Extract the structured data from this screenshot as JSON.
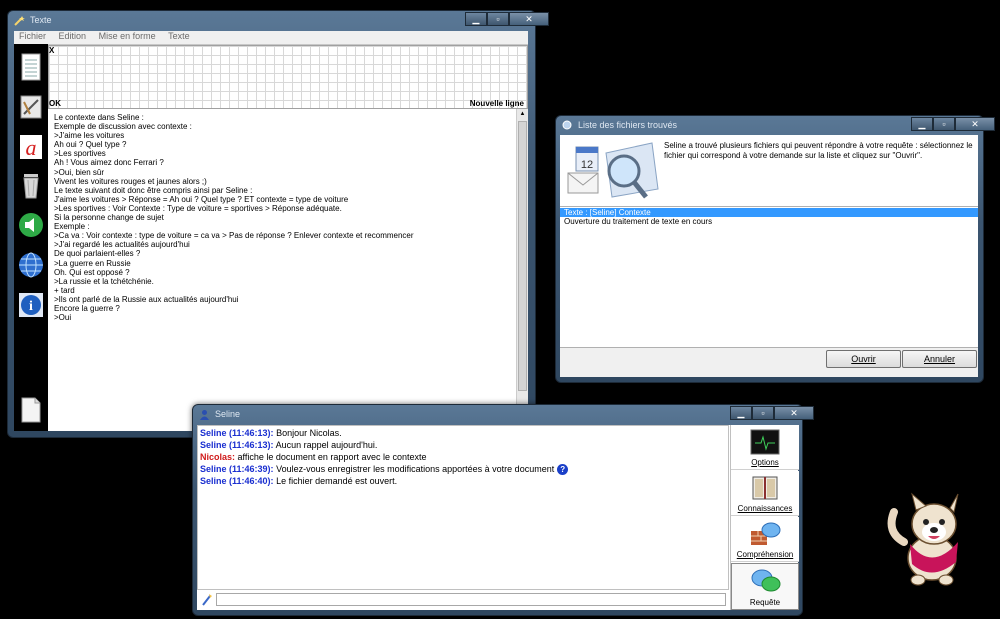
{
  "texte_window": {
    "title": "Texte",
    "menu": [
      "Fichier",
      "Edition",
      "Mise en forme",
      "Texte"
    ],
    "grid_label_x": "X",
    "grid_label_ok": "OK",
    "grid_label_newline": "Nouvelle ligne",
    "sidebar_icons": [
      "notepad-icon",
      "drawing-tools-icon",
      "font-letter-a-icon",
      "trash-icon",
      "speaker-icon",
      "globe-icon",
      "info-icon",
      "document-icon"
    ],
    "lines": [
      "Le contexte dans Seline :",
      "",
      "Exemple de discussion avec contexte :",
      "",
      ">J'aime les voitures",
      "Ah oui ? Quel type ?",
      ">Les sportives",
      "Ah ! Vous aimez donc Ferrari ?",
      ">Oui, bien sûr",
      "Vivent les voitures rouges et jaunes alors ;)",
      "",
      "Le texte suivant doit donc être compris ainsi par Seline :",
      "",
      "J'aime les voitures > Réponse = Ah oui ? Quel type ? ET contexte = type de voiture",
      "",
      ">Les sportives : Voir Contexte : Type de voiture = sportives > Réponse adéquate.",
      "Si la personne change de sujet",
      "",
      "Exemple :",
      "",
      ">Ca va : Voir contexte : type de voiture = ca va > Pas de réponse ? Enlever contexte et recommencer",
      "",
      ">J'ai regardé les actualités aujourd'hui",
      "De quoi parlaient-elles ?",
      ">La guerre en Russie",
      "Oh. Qui est opposé ?",
      ">La russie et la tchétchénie.",
      "",
      "+ tard",
      "",
      ">Ils ont parlé de la Russie aux actualités aujourd'hui",
      "Encore la guerre ?",
      ">Oui"
    ]
  },
  "files_window": {
    "title": "Liste des fichiers trouvés",
    "message": "Seline a trouvé plusieurs fichiers qui peuvent répondre à votre requête : sélectionnez le fichier qui correspond à votre demande sur la liste et cliquez sur \"Ouvrir\".",
    "files": [
      "Texte : [Seline] Contexte",
      "Ouverture du traitement de texte en cours"
    ],
    "selected_index": 0,
    "open_label": "Ouvrir",
    "cancel_label": "Annuler"
  },
  "seline_window": {
    "title": "Seline",
    "messages": [
      {
        "who": "Seline (11:46:13):",
        "text": "Bonjour Nicolas.",
        "color": "#1a2fd0"
      },
      {
        "who": "Seline (11:46:13):",
        "text": "Aucun rappel aujourd'hui.",
        "color": "#1a2fd0"
      },
      {
        "who": "Nicolas:",
        "text": "affiche le document en rapport avec le contexte",
        "color": "#d01a1a"
      },
      {
        "who": "Seline (11:46:39):",
        "text": "Voulez-vous enregistrer les modifications apportées à votre document",
        "color": "#1a2fd0"
      },
      {
        "who": "Seline (11:46:40):",
        "text": "Le fichier demandé est ouvert.",
        "color": "#1a2fd0"
      }
    ],
    "side_buttons": [
      {
        "label": "Options",
        "icon": "monitor-icon"
      },
      {
        "label": "Connaissances",
        "icon": "book-icon"
      },
      {
        "label": "Compréhension",
        "icon": "brick-speech-icon"
      },
      {
        "label": "Requête",
        "icon": "speech-bubbles-icon"
      }
    ],
    "input_value": ""
  },
  "colors": {
    "selection": "#3399ff",
    "seline_name": "#1a2fd0",
    "user_name": "#d01a1a",
    "title_text": "#dfe8f2"
  },
  "mascot": "dog-mascot-icon"
}
